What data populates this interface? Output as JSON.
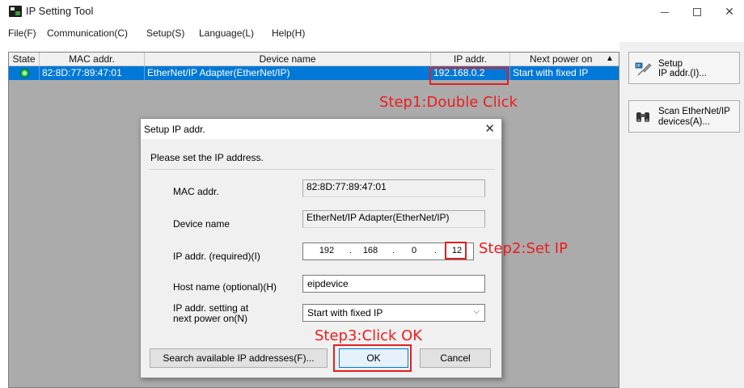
{
  "window": {
    "title": "IP Setting Tool"
  },
  "menu": [
    {
      "label": "File(F)"
    },
    {
      "label": "Communication(C)"
    },
    {
      "label": "Setup(S)"
    },
    {
      "label": "Language(L)"
    },
    {
      "label": "Help(H)"
    }
  ],
  "table": {
    "columns": [
      "State",
      "MAC addr.",
      "Device name",
      "IP addr.",
      "Next power on"
    ],
    "sort_indicator": "▲",
    "rows": [
      {
        "state": "online",
        "mac": "82:8D:77:89:47:01",
        "device_name": "EtherNet/IP Adapter(EtherNet/IP)",
        "ip": "192.168.0.2",
        "next_power_on": "Start with fixed IP"
      }
    ]
  },
  "side_buttons": {
    "setup": {
      "line1": "Setup",
      "line2": "IP addr.(I)..."
    },
    "scan": {
      "line1": "Scan EtherNet/IP",
      "line2": "devices(A)..."
    }
  },
  "dialog": {
    "title": "Setup IP addr.",
    "close": "✕",
    "heading": "Please set the IP address.",
    "mac_label": "MAC addr.",
    "mac_value": "82:8D:77:89:47:01",
    "device_label": "Device name",
    "device_value": "EtherNet/IP Adapter(EtherNet/IP)",
    "ip_label": "IP addr. (required)(I)",
    "ip_octets": [
      "192",
      "168",
      "0",
      "12"
    ],
    "host_label": "Host name (optional)(H)",
    "host_value": "eipdevice",
    "next_label_1": "IP addr. setting at",
    "next_label_2": "next power on(N)",
    "next_value": "Start with fixed IP",
    "search_button": "Search available IP addresses(F)...",
    "ok_button": "OK",
    "cancel_button": "Cancel"
  },
  "annotations": {
    "step1": "Step1:Double Click",
    "step2": "Step2:Set IP",
    "step3": "Step3:Click OK"
  },
  "colors": {
    "selection": "#0078d7",
    "annotation": "#ee1c1c",
    "status_online": "#2ecc40"
  }
}
